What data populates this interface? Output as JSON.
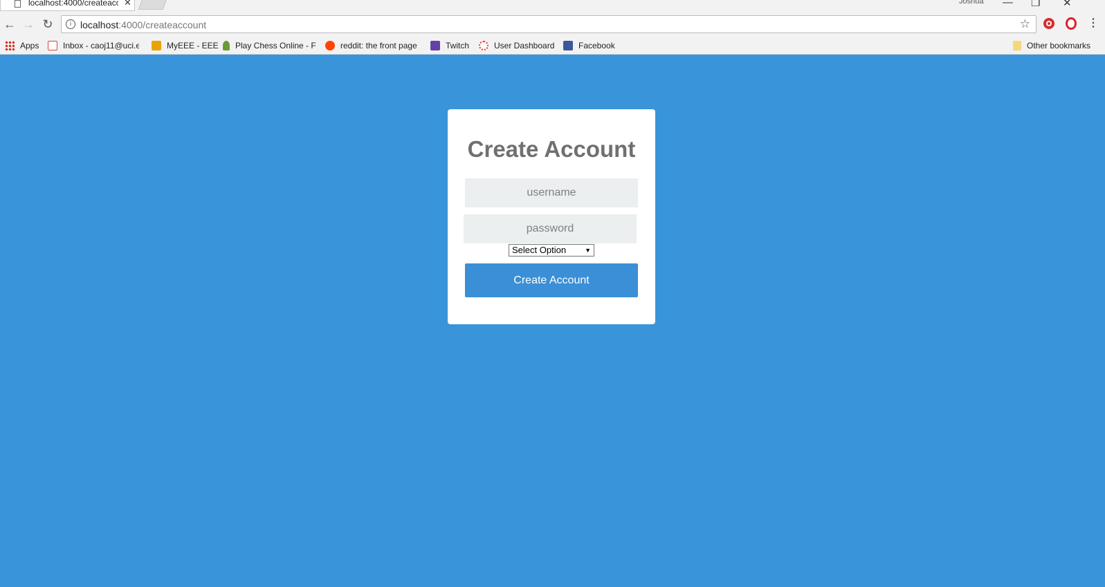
{
  "browser": {
    "tab_title": "localhost:4000/createacc",
    "tab_close": "✕",
    "profile_name": "Joshua",
    "window_controls": {
      "minimize": "—",
      "restore": "❐",
      "close": "✕"
    },
    "nav": {
      "back": "←",
      "forward": "→",
      "reload": "↻"
    },
    "url_host": "localhost",
    "url_path": ":4000/createaccount",
    "star": "☆",
    "menu": "⋮",
    "bookmarks": [
      {
        "label": "Apps",
        "icon": "apps-grid-icon",
        "color": "#d93025"
      },
      {
        "label": "Inbox - caoj11@uci.e",
        "icon": "gmail-icon",
        "color": "#d44638"
      },
      {
        "label": "MyEEE - EEE",
        "icon": "myeee-icon",
        "color": "#e8a400"
      },
      {
        "label": "Play Chess Online - F",
        "icon": "chess-pawn-icon",
        "color": "#6a9a3a"
      },
      {
        "label": "reddit: the front page",
        "icon": "reddit-icon",
        "color": "#ff4500"
      },
      {
        "label": "Twitch",
        "icon": "twitch-icon",
        "color": "#6441a5"
      },
      {
        "label": "User Dashboard",
        "icon": "dashboard-icon",
        "color": "#e53935"
      },
      {
        "label": "Facebook",
        "icon": "facebook-icon",
        "color": "#3b5998"
      }
    ],
    "other_bookmarks": "Other bookmarks"
  },
  "page": {
    "background": "#3994d9",
    "title": "Create Account",
    "username_placeholder": "username",
    "password_placeholder": "password",
    "select_value": "Select Option",
    "select_arrow": "▼",
    "submit_label": "Create Account",
    "button_color": "#3a8fd6"
  }
}
